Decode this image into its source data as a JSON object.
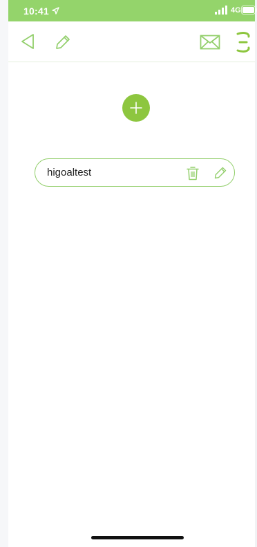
{
  "status_bar": {
    "time": "10:41",
    "network": "4G"
  },
  "nav": {
    "back_icon": "back-triangle-icon",
    "edit_icon": "pencil-icon",
    "mail_icon": "mail-icon",
    "more_icon": "menu-icon"
  },
  "add_button": {
    "icon": "plus-icon"
  },
  "items": [
    {
      "name": "higoaltest",
      "delete_icon": "trash-icon",
      "edit_icon": "pencil-icon"
    }
  ],
  "colors": {
    "accent": "#8dc63f",
    "status_bar": "#94d46b",
    "outline": "#93cf6c"
  }
}
